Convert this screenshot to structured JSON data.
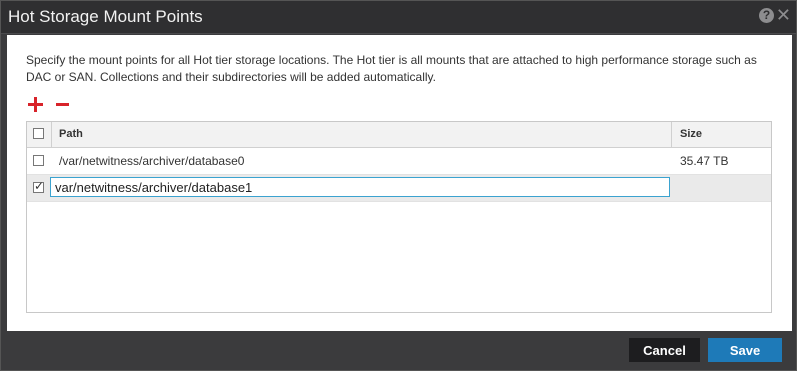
{
  "dialog": {
    "title": "Hot Storage Mount Points",
    "description": "Specify the mount points for all Hot tier storage locations. The Hot tier is all mounts that are attached to high performance storage such as DAC or SAN. Collections and their subdirectories will be added automatically.",
    "icons": {
      "help": "help-icon",
      "close": "close-icon",
      "add": "plus-icon",
      "remove": "minus-icon"
    }
  },
  "table": {
    "columns": {
      "path": "Path",
      "size": "Size"
    },
    "rows": [
      {
        "path": "/var/netwitness/archiver/database0",
        "size": "35.47 TB",
        "checked": false
      },
      {
        "path": "var/netwitness/archiver/database1",
        "size": "",
        "checked": true
      }
    ]
  },
  "footer": {
    "cancel_label": "Cancel",
    "save_label": "Save"
  },
  "colors": {
    "accent": "#1e7ab8",
    "danger": "#d8232a",
    "titlebar": "#2f2f31"
  }
}
